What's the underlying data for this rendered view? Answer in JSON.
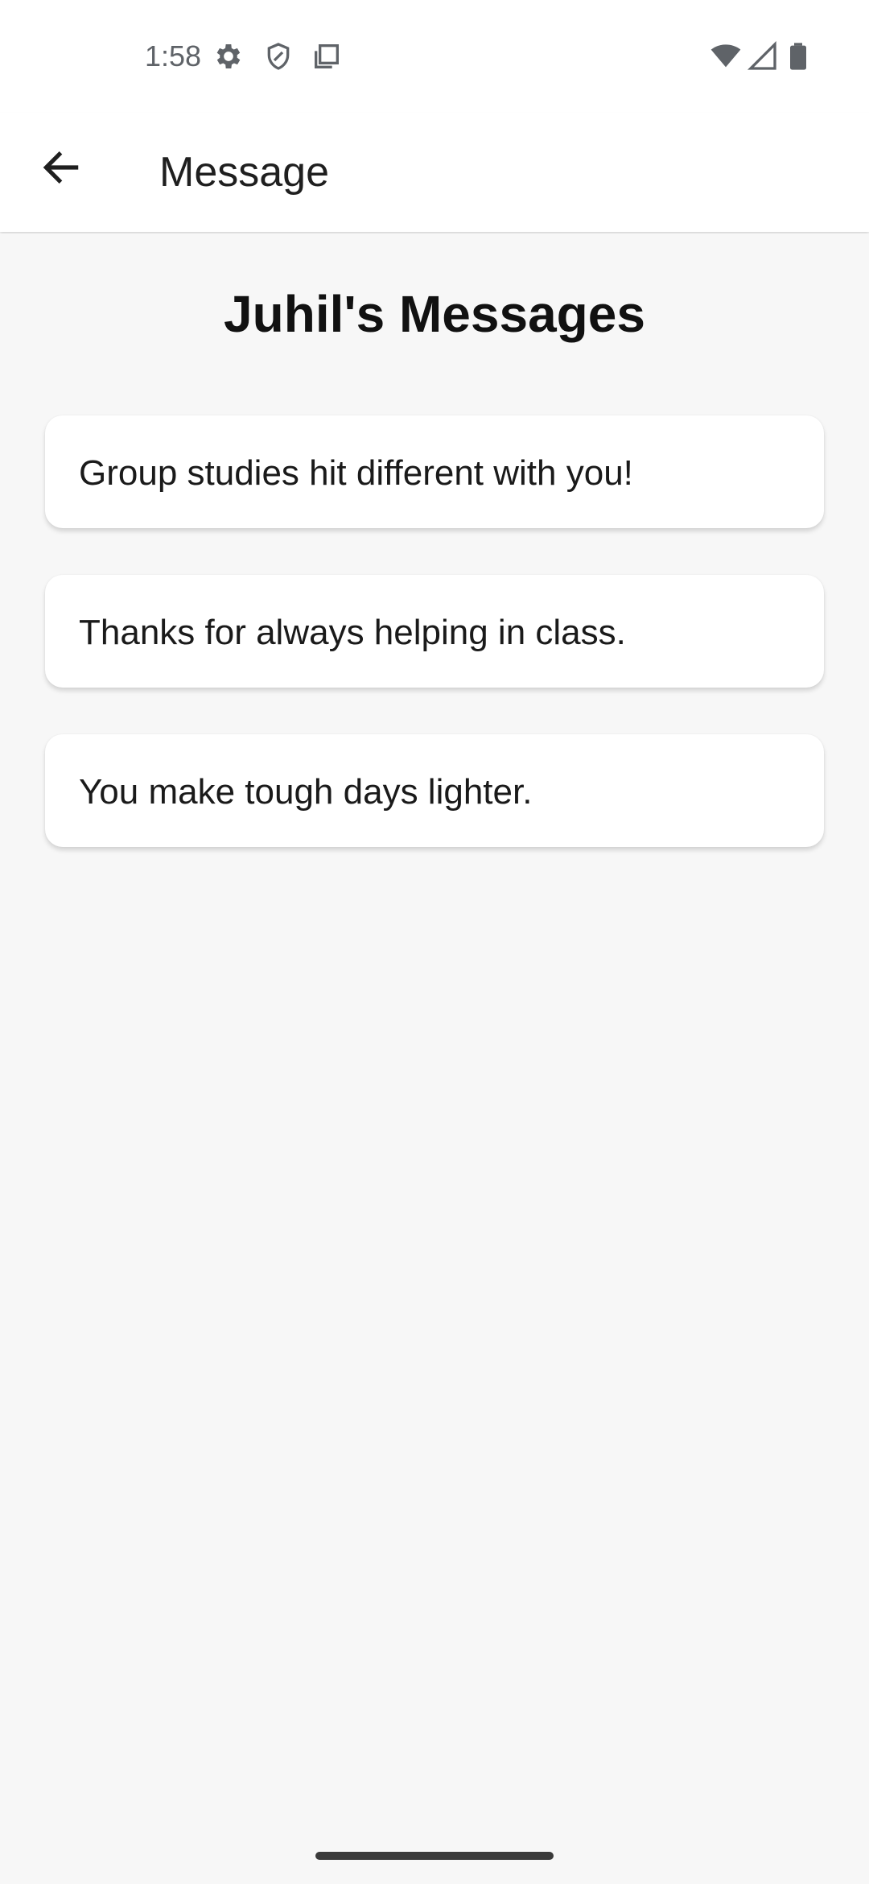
{
  "status_bar": {
    "time": "1:58",
    "icons_left": [
      "gear-icon",
      "shield-icon",
      "copy-icon"
    ],
    "icons_right": [
      "wifi-icon",
      "signal-icon",
      "battery-icon"
    ]
  },
  "app_bar": {
    "back_icon": "arrow-left-icon",
    "title": "Message"
  },
  "page": {
    "title": "Juhil's Messages",
    "messages": [
      "Group studies hit different with you!",
      "Thanks for always helping in class.",
      "You make tough days lighter."
    ]
  },
  "colors": {
    "background": "#f7f7f7",
    "card": "#ffffff",
    "text": "#1a1a1a"
  }
}
